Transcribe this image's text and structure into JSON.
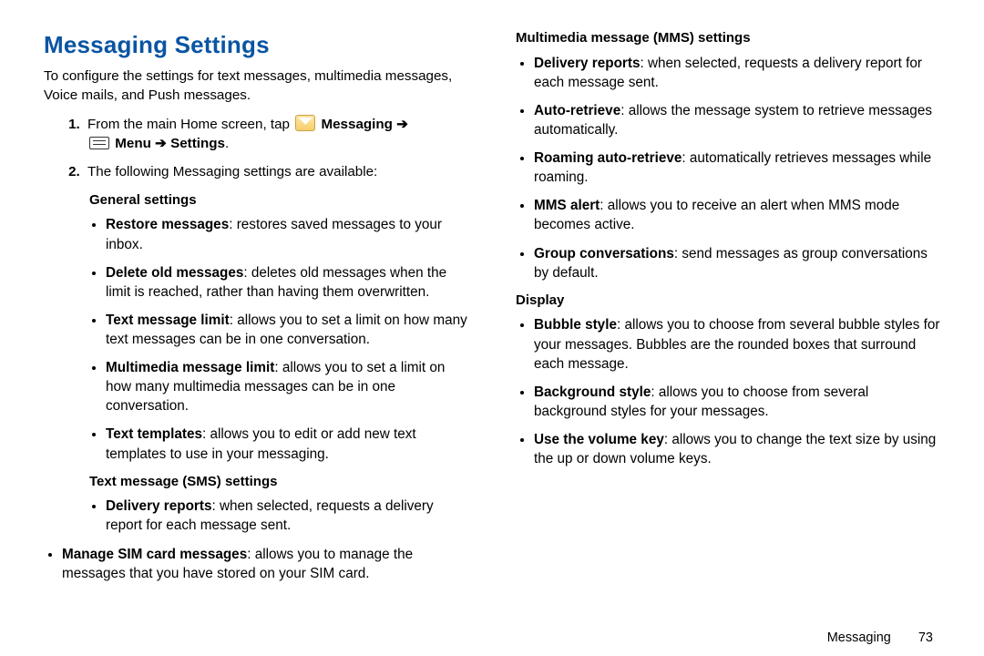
{
  "title": "Messaging Settings",
  "intro": "To configure the settings for text messages, multimedia messages, Voice mails, and Push messages.",
  "step1": {
    "pre": "From the main Home screen, tap ",
    "messaging_bold": "Messaging",
    "arrow1": "➔",
    "menu_bold": "Menu",
    "arrow2": "➔",
    "settings_bold": "Settings",
    "period": "."
  },
  "step2": "The following Messaging settings are available:",
  "general_head": "General settings",
  "general": [
    {
      "label": "Restore messages",
      "desc": ": restores saved messages to your inbox."
    },
    {
      "label": "Delete old messages",
      "desc": ": deletes old messages when the limit is reached, rather than having them overwritten."
    },
    {
      "label": "Text message limit",
      "desc": ": allows you to set a limit on how many text messages can be in one conversation."
    },
    {
      "label": "Multimedia message limit",
      "desc": ": allows you to set a limit on how many multimedia messages can be in one conversation."
    },
    {
      "label": "Text templates",
      "desc": ": allows you to edit or add new text templates to use in your messaging."
    }
  ],
  "sms_head": "Text message (SMS) settings",
  "sms": [
    {
      "label": "Delivery reports",
      "desc": ": when selected, requests a delivery report for each message sent."
    },
    {
      "label": "Manage SIM card messages",
      "desc": ": allows you to manage the messages that you have stored on your SIM card."
    }
  ],
  "mms_head": "Multimedia message (MMS) settings",
  "mms": [
    {
      "label": "Delivery reports",
      "desc": ": when selected, requests a delivery report for each message sent."
    },
    {
      "label": "Auto-retrieve",
      "desc": ": allows the message system to retrieve messages automatically."
    },
    {
      "label": "Roaming auto-retrieve",
      "desc": ": automatically retrieves messages while roaming."
    },
    {
      "label": "MMS alert",
      "desc": ": allows you to receive an alert when MMS mode becomes active."
    },
    {
      "label": "Group conversations",
      "desc": ": send messages as group conversations by default."
    }
  ],
  "display_head": "Display",
  "display": [
    {
      "label": "Bubble style",
      "desc": ": allows you to choose from several bubble styles for your messages. Bubbles are the rounded boxes that surround each message."
    },
    {
      "label": "Background style",
      "desc": ": allows you to choose from several background styles for your messages."
    },
    {
      "label": "Use the volume key",
      "desc": ": allows you to change the text size by using the up or down volume keys."
    }
  ],
  "footer_section": "Messaging",
  "footer_page": "73"
}
